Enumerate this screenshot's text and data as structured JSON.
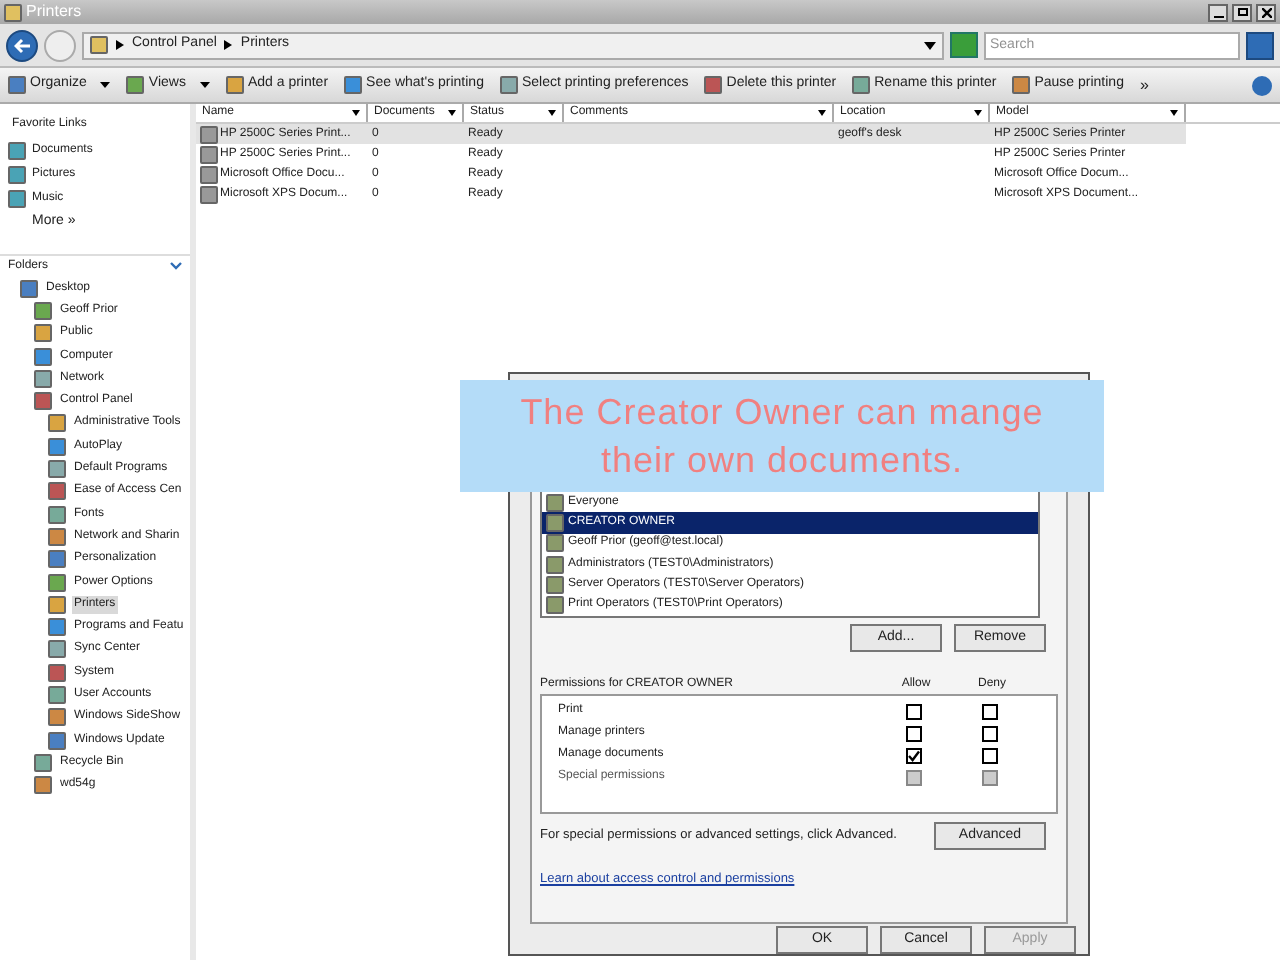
{
  "window": {
    "title": "Printers"
  },
  "address": {
    "path": [
      "Control Panel",
      "Printers"
    ],
    "search_placeholder": "Search"
  },
  "toolbar": [
    {
      "label": "Organize",
      "dropdown": true
    },
    {
      "label": "Views",
      "dropdown": true
    },
    {
      "label": "Add a printer",
      "dropdown": false
    },
    {
      "label": "See what's printing",
      "dropdown": false
    },
    {
      "label": "Select printing preferences",
      "dropdown": false
    },
    {
      "label": "Delete this printer",
      "dropdown": false
    },
    {
      "label": "Rename this printer",
      "dropdown": false
    },
    {
      "label": "Pause printing",
      "dropdown": false
    }
  ],
  "toolbar_more": "»",
  "favorite_links": {
    "title": "Favorite Links",
    "items": [
      "Documents",
      "Pictures",
      "Music"
    ],
    "more": "More",
    "more_glyph": "»"
  },
  "folders": {
    "title": "Folders",
    "tree": [
      {
        "label": "Desktop",
        "selected": false,
        "children": [
          {
            "label": "Geoff Prior",
            "selected": false
          },
          {
            "label": "Public",
            "selected": false
          },
          {
            "label": "Computer",
            "selected": false
          },
          {
            "label": "Network",
            "selected": false
          },
          {
            "label": "Control Panel",
            "selected": false,
            "children": [
              {
                "label": "Administrative Tools",
                "selected": false
              },
              {
                "label": "AutoPlay",
                "selected": false
              },
              {
                "label": "Default Programs",
                "selected": false
              },
              {
                "label": "Ease of Access Cen",
                "selected": false
              },
              {
                "label": "Fonts",
                "selected": false
              },
              {
                "label": "Network and Sharin",
                "selected": false
              },
              {
                "label": "Personalization",
                "selected": false
              },
              {
                "label": "Power Options",
                "selected": false
              },
              {
                "label": "Printers",
                "selected": true
              },
              {
                "label": "Programs and Featu",
                "selected": false
              },
              {
                "label": "Sync Center",
                "selected": false
              },
              {
                "label": "System",
                "selected": false
              },
              {
                "label": "User Accounts",
                "selected": false
              },
              {
                "label": "Windows SideShow",
                "selected": false
              },
              {
                "label": "Windows Update",
                "selected": false
              }
            ]
          },
          {
            "label": "Recycle Bin",
            "selected": false
          },
          {
            "label": "wd54g",
            "selected": false
          }
        ]
      }
    ]
  },
  "table": {
    "columns": [
      "Name",
      "Documents",
      "Status",
      "Comments",
      "Location",
      "Model"
    ],
    "rows": [
      {
        "cells": [
          "HP 2500C Series Print...",
          "0",
          "Ready",
          "",
          "geoff's desk",
          "HP 2500C Series Printer"
        ],
        "selected": true
      },
      {
        "cells": [
          "HP 2500C Series Print...",
          "0",
          "Ready",
          "",
          "",
          "HP 2500C Series Printer"
        ],
        "selected": false
      },
      {
        "cells": [
          "Microsoft Office Docu...",
          "0",
          "Ready",
          "",
          "",
          "Microsoft Office Docum..."
        ],
        "selected": false
      },
      {
        "cells": [
          "Microsoft XPS Docum...",
          "0",
          "Ready",
          "",
          "",
          "Microsoft XPS Document..."
        ],
        "selected": false
      }
    ]
  },
  "dialog": {
    "principals": [
      {
        "label": "Everyone",
        "selected": false
      },
      {
        "label": "CREATOR OWNER",
        "selected": true
      },
      {
        "label": "Geoff Prior (geoff@test.local)",
        "selected": false
      },
      {
        "label": "Administrators (TEST0\\Administrators)",
        "selected": false
      },
      {
        "label": "Server Operators (TEST0\\Server Operators)",
        "selected": false
      },
      {
        "label": "Print Operators (TEST0\\Print Operators)",
        "selected": false
      }
    ],
    "add_button": "Add...",
    "remove_button": "Remove",
    "permissions_title": "Permissions for CREATOR OWNER",
    "allow_label": "Allow",
    "deny_label": "Deny",
    "permissions": [
      {
        "name": "Print",
        "allow": false,
        "deny": false,
        "disabled": false
      },
      {
        "name": "Manage printers",
        "allow": false,
        "deny": false,
        "disabled": false
      },
      {
        "name": "Manage documents",
        "allow": true,
        "deny": false,
        "disabled": false
      },
      {
        "name": "Special permissions",
        "allow": false,
        "deny": false,
        "disabled": true
      }
    ],
    "advanced_note": "For special permissions or advanced settings, click Advanced.",
    "advanced_button": "Advanced",
    "link": "Learn about access control and permissions",
    "buttons": [
      {
        "label": "OK",
        "disabled": false
      },
      {
        "label": "Cancel",
        "disabled": false
      },
      {
        "label": "Apply",
        "disabled": true
      }
    ]
  },
  "caption": "The Creator Owner can mange their own documents."
}
